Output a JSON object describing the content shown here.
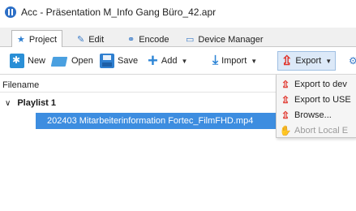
{
  "window": {
    "title": "Acc - Präsentation M_Info Gang Büro_42.apr"
  },
  "tabs": [
    {
      "label": "Project",
      "icon": "star-icon"
    },
    {
      "label": "Edit",
      "icon": "pencil-icon"
    },
    {
      "label": "Encode",
      "icon": "encode-icon"
    },
    {
      "label": "Device Manager",
      "icon": "monitor-icon"
    }
  ],
  "toolbar": {
    "new_label": "New",
    "open_label": "Open",
    "save_label": "Save",
    "add_label": "Add",
    "import_label": "Import",
    "export_label": "Export"
  },
  "list": {
    "column_header": "Filename",
    "playlist_label": "Playlist 1",
    "files": [
      "202403 Mitarbeiterinformation Fortec_FilmFHD.mp4"
    ]
  },
  "export_menu": {
    "items": [
      {
        "label": "Export to dev",
        "icon": "export-icon",
        "enabled": true
      },
      {
        "label": "Export to USE",
        "icon": "export-icon",
        "enabled": true
      },
      {
        "label": "Browse...",
        "icon": "export-icon",
        "enabled": true
      },
      {
        "label": "Abort Local E",
        "icon": "hand-icon",
        "enabled": false
      }
    ]
  },
  "colors": {
    "selection": "#3d8de0",
    "accent_blue": "#2f86d6",
    "export_red": "#e0342b"
  }
}
